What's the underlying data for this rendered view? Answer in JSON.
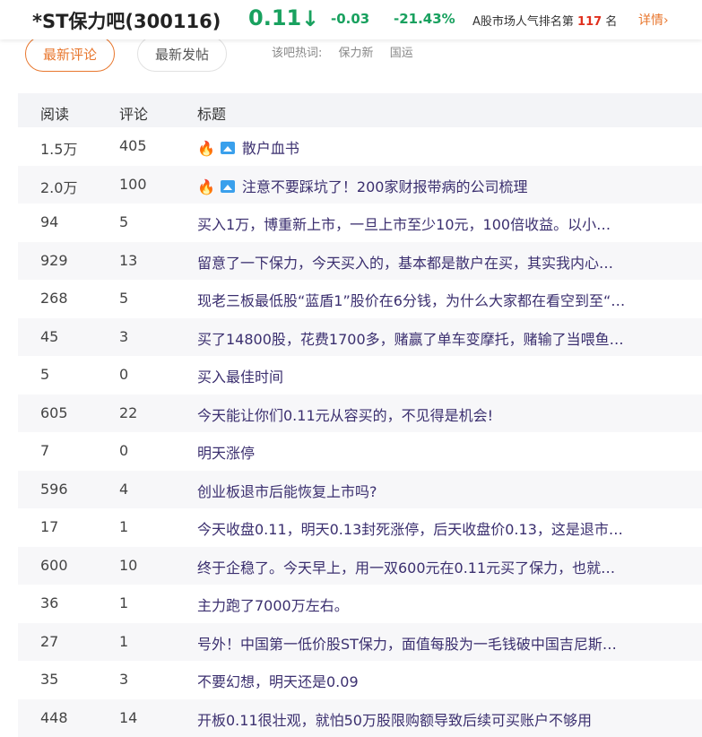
{
  "header": {
    "stock_name": "*ST保力吧(300116)",
    "price": "0.11",
    "arrow": "↓",
    "change": "-0.03",
    "change_pct": "-21.43%",
    "rank_prefix": "A股市场人气排名第",
    "rank_number": "117",
    "rank_suffix": "名",
    "detail_link": "详情",
    "detail_chevron": "›"
  },
  "tabs": {
    "latest_comment": "最新评论",
    "latest_post": "最新发帖",
    "hot_words_label": "该吧热词:",
    "hot_words": [
      "保力新",
      "国运"
    ]
  },
  "table": {
    "headers": {
      "read": "阅读",
      "comments": "评论",
      "title": "标题"
    },
    "rows": [
      {
        "read": "1.5万",
        "comments": "405",
        "title": "散户血书",
        "hot": true
      },
      {
        "read": "2.0万",
        "comments": "100",
        "title": "注意不要踩坑了！200家财报带病的公司梳理",
        "hot": true
      },
      {
        "read": "94",
        "comments": "5",
        "title": "买入1万，博重新上市，一旦上市至少10元，100倍收益。以小…",
        "hot": false
      },
      {
        "read": "929",
        "comments": "13",
        "title": "留意了一下保力，今天买入的，基本都是散户在买，其实我内心…",
        "hot": false
      },
      {
        "read": "268",
        "comments": "5",
        "title": "现老三板最低股“蓝盾1”股价在6分钱，为什么大家都在看空到至“…",
        "hot": false
      },
      {
        "read": "45",
        "comments": "3",
        "title": "买了14800股，花费1700多，赌赢了单车变摩托，赌输了当喂鱼…",
        "hot": false
      },
      {
        "read": "5",
        "comments": "0",
        "title": "买入最佳时间",
        "hot": false
      },
      {
        "read": "605",
        "comments": "22",
        "title": "今天能让你们0.11元从容买的，不见得是机会!",
        "hot": false
      },
      {
        "read": "7",
        "comments": "0",
        "title": "明天涨停",
        "hot": false
      },
      {
        "read": "596",
        "comments": "4",
        "title": "创业板退市后能恢复上市吗?",
        "hot": false
      },
      {
        "read": "17",
        "comments": "1",
        "title": "今天收盘0.11，明天0.13封死涨停，后天收盘价0.13，这是退市…",
        "hot": false
      },
      {
        "read": "600",
        "comments": "10",
        "title": "终于企稳了。今天早上，用一双600元在0.11元买了保力，也就…",
        "hot": false
      },
      {
        "read": "36",
        "comments": "1",
        "title": "主力跑了7000万左右。",
        "hot": false
      },
      {
        "read": "27",
        "comments": "1",
        "title": "号外！中国第一低价股ST保力，面值每股为一毛钱破中国吉尼斯…",
        "hot": false
      },
      {
        "read": "35",
        "comments": "3",
        "title": "不要幻想，明天还是0.09",
        "hot": false
      },
      {
        "read": "448",
        "comments": "14",
        "title": "开板0.11很壮观，就怕50万股限购额导致后续可买账户不够用",
        "hot": false
      }
    ]
  },
  "icons": {
    "fire": "fire-icon",
    "image": "image-icon"
  },
  "colors": {
    "down": "#19a15f",
    "accent": "#e8772e",
    "rank": "#e0301e",
    "title_link": "#3b2f6f"
  }
}
